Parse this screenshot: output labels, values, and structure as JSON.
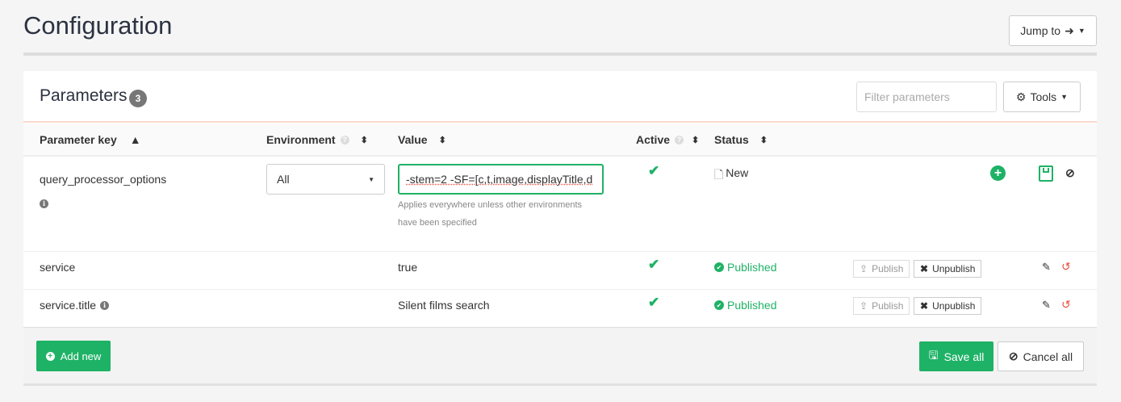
{
  "page": {
    "title": "Configuration",
    "jump_to": "Jump to"
  },
  "panel": {
    "title": "Parameters",
    "count": "3",
    "filter_placeholder": "Filter parameters",
    "tools": "Tools"
  },
  "columns": {
    "key": "Parameter key",
    "environment": "Environment",
    "value": "Value",
    "active": "Active",
    "status": "Status"
  },
  "rows": [
    {
      "key": "query_processor_options",
      "environment": "All",
      "value": "-stem=2 -SF=[c,t,image,displayTitle,d",
      "help": [
        "Applies everywhere unless other environments",
        "have been specified"
      ],
      "status": "New"
    },
    {
      "key": "service",
      "value": "true",
      "status": "Published",
      "publish": "Publish",
      "unpublish": "Unpublish"
    },
    {
      "key": "service.title",
      "value": "Silent films search",
      "status": "Published",
      "publish": "Publish",
      "unpublish": "Unpublish"
    }
  ],
  "footer": {
    "add_new": "Add new",
    "save_all": "Save all",
    "cancel_all": "Cancel all"
  },
  "colors": {
    "green": "#1eb266",
    "red": "#e74c3c"
  }
}
